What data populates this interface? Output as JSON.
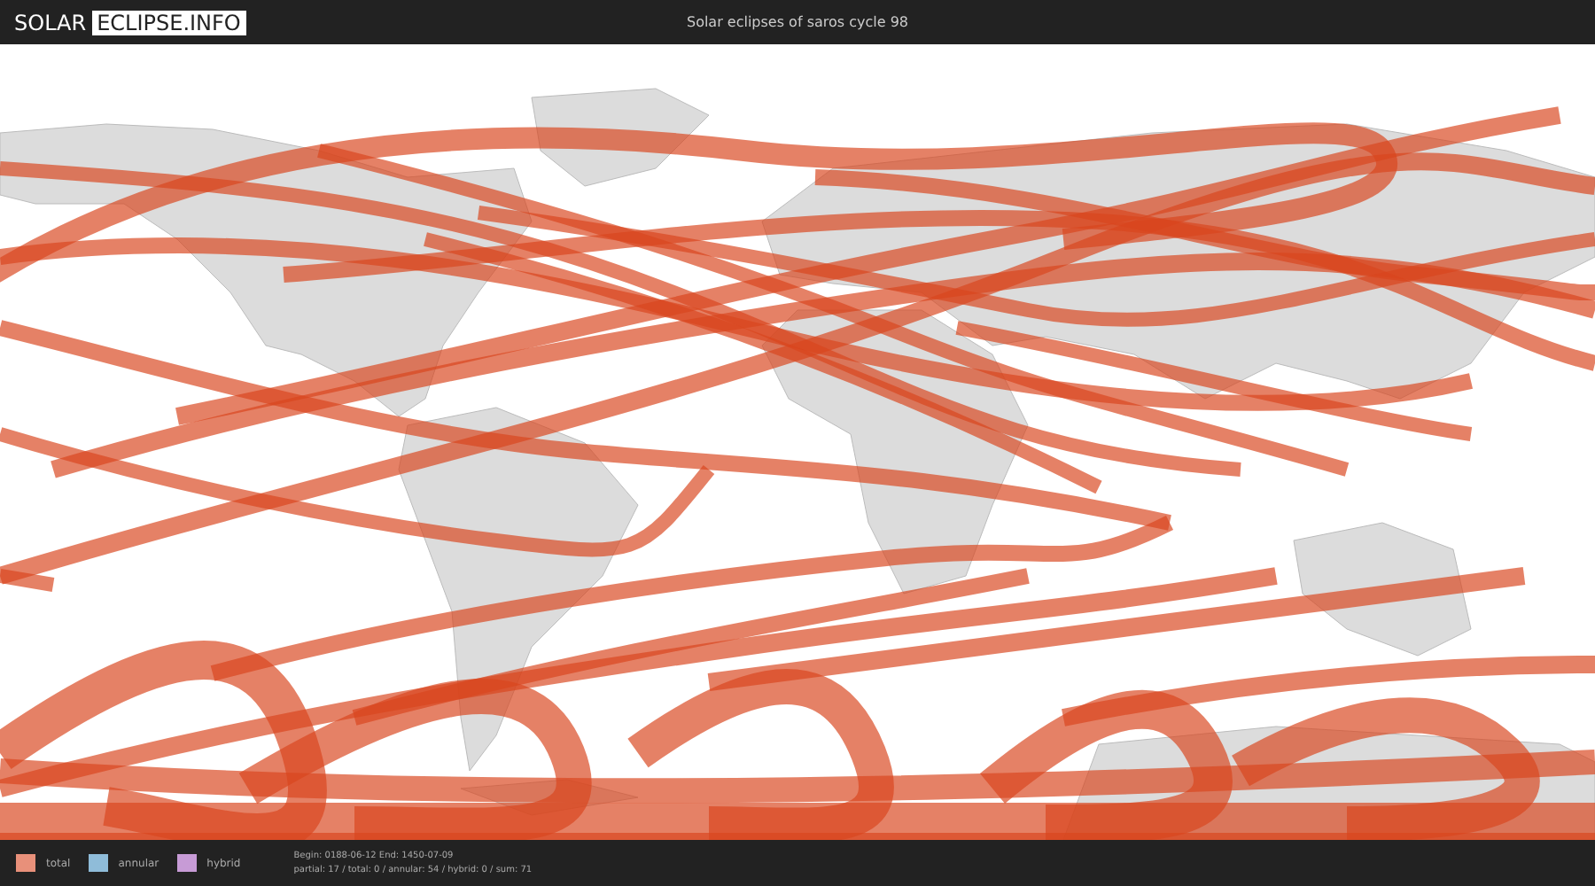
{
  "header": {
    "logo": {
      "left": "SOLAR",
      "right": "ECLIPSE.INFO"
    },
    "title": "Solar eclipses of saros cycle 98"
  },
  "legend": [
    {
      "label": "total",
      "color": "#e8907a"
    },
    {
      "label": "annular",
      "color": "#8fbcd9"
    },
    {
      "label": "hybrid",
      "color": "#c79bd6"
    }
  ],
  "summary": [
    "Begin: 0188-06-12 End: 1450-07-09",
    "partial: 17 / total: 0 / annular: 54 / hybrid: 0 / sum: 71"
  ]
}
